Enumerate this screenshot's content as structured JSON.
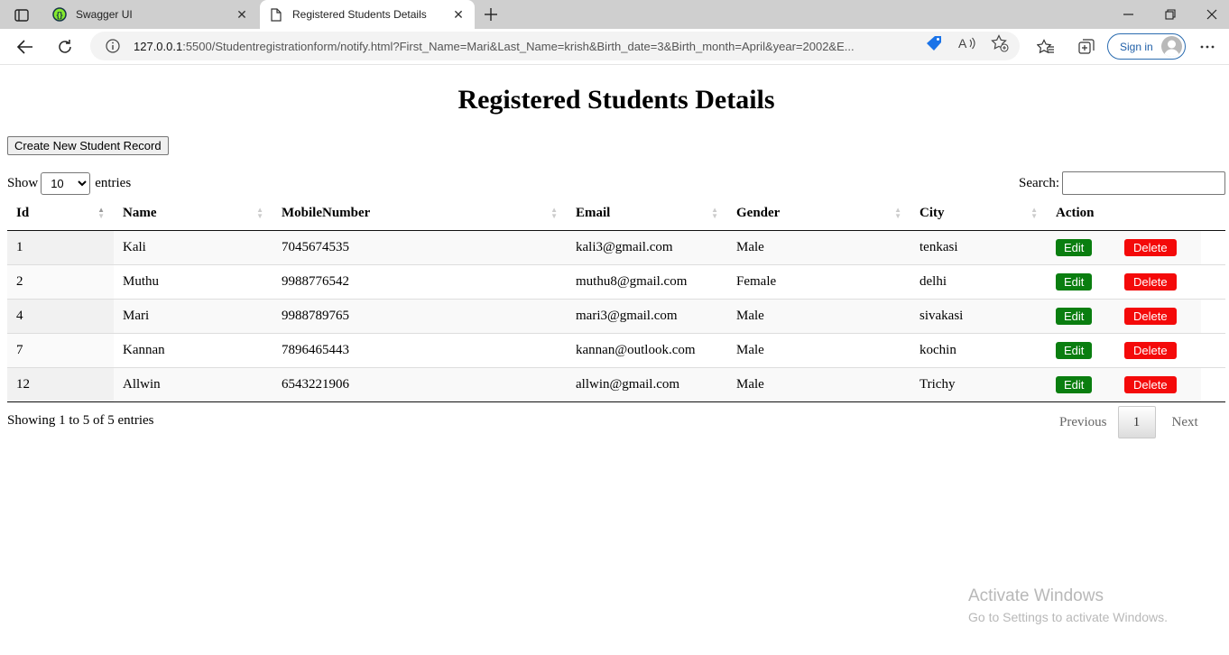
{
  "browser": {
    "tabs": [
      {
        "title": "Swagger UI",
        "icon": "swagger-icon"
      },
      {
        "title": "Registered Students Details",
        "icon": "page-icon"
      }
    ],
    "url_host": "127.0.0.1",
    "url_rest": ":5500/Studentregistrationform/notify.html?First_Name=Mari&Last_Name=krish&Birth_date=3&Birth_month=April&year=2002&E...",
    "sign_in_label": "Sign in"
  },
  "page": {
    "title": "Registered Students Details",
    "create_button": "Create New Student Record",
    "length": {
      "show": "Show",
      "value": "10",
      "entries": "entries"
    },
    "search_label": "Search:",
    "columns": [
      "Id",
      "Name",
      "MobileNumber",
      "Email",
      "Gender",
      "City",
      "Action"
    ],
    "rows": [
      {
        "id": "1",
        "name": "Kali",
        "mobile": "7045674535",
        "email": "kali3@gmail.com",
        "gender": "Male",
        "city": "tenkasi"
      },
      {
        "id": "2",
        "name": "Muthu",
        "mobile": "9988776542",
        "email": "muthu8@gmail.com",
        "gender": "Female",
        "city": "delhi"
      },
      {
        "id": "4",
        "name": "Mari",
        "mobile": "9988789765",
        "email": "mari3@gmail.com",
        "gender": "Male",
        "city": "sivakasi"
      },
      {
        "id": "7",
        "name": "Kannan",
        "mobile": "7896465443",
        "email": "kannan@outlook.com",
        "gender": "Male",
        "city": "kochin"
      },
      {
        "id": "12",
        "name": "Allwin",
        "mobile": "6543221906",
        "email": "allwin@gmail.com",
        "gender": "Male",
        "city": "Trichy"
      }
    ],
    "edit_label": "Edit",
    "delete_label": "Delete",
    "info": "Showing 1 to 5 of 5 entries",
    "pager": {
      "previous": "Previous",
      "page": "1",
      "next": "Next"
    },
    "colors": {
      "edit": "#0a7e10",
      "delete": "#f40a0a"
    }
  },
  "watermark": {
    "line1": "Activate Windows",
    "line2": "Go to Settings to activate Windows."
  }
}
